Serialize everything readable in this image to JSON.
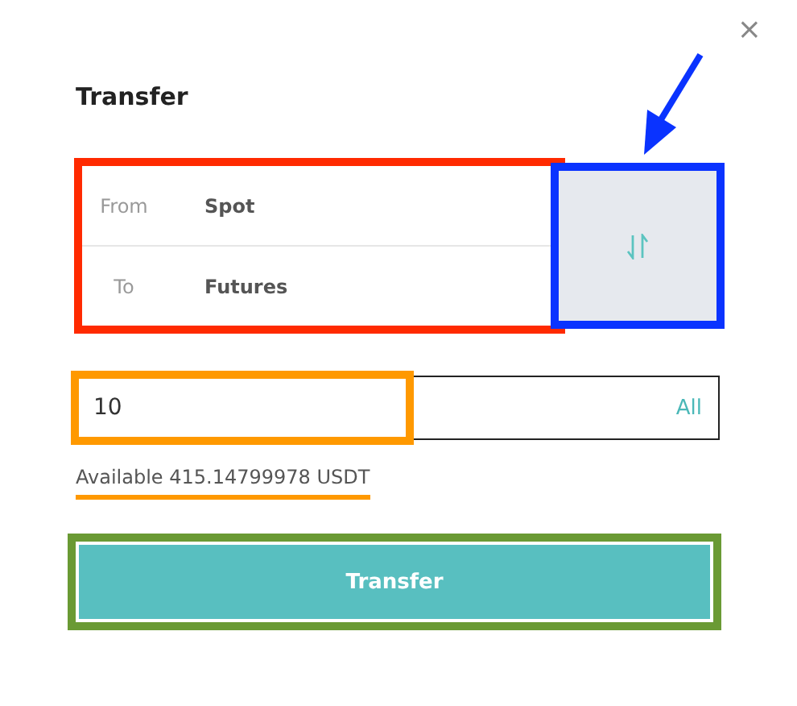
{
  "dialog": {
    "title": "Transfer",
    "close": "×"
  },
  "account_panel": {
    "rows": [
      {
        "label": "From",
        "value": "Spot"
      },
      {
        "label": "To",
        "value": "Futures"
      }
    ]
  },
  "amount": {
    "value": "10",
    "max_link": "All"
  },
  "available": {
    "text": "Available 415.14799978 USDT"
  },
  "submit": {
    "label": "Transfer"
  },
  "annotations": [
    {
      "kind": "box",
      "color": "#ff2a00"
    },
    {
      "kind": "box",
      "color": "#0a33ff"
    },
    {
      "kind": "arrow",
      "color": "#0a33ff"
    },
    {
      "kind": "box",
      "color": "#ff9900"
    },
    {
      "kind": "underline",
      "color": "#ff9900"
    },
    {
      "kind": "box",
      "color": "#6a9a34"
    }
  ]
}
